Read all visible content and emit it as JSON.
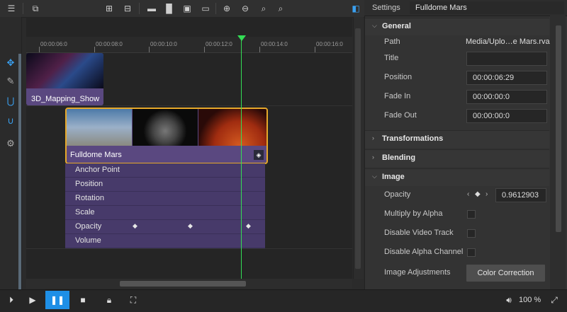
{
  "timeline": {
    "ruler_ticks": [
      "00:00:06:0",
      "00:00:08:0",
      "00:00:10:0",
      "00:00:12:0",
      "00:00:14:0",
      "00:00:16:0"
    ]
  },
  "clips": {
    "clip1": {
      "label": "3D_Mapping_Show"
    },
    "clip2": {
      "label": "Fulldome Mars"
    }
  },
  "properties": [
    "Anchor Point",
    "Position",
    "Rotation",
    "Scale",
    "Opacity",
    "Volume"
  ],
  "settings": {
    "title": "Settings",
    "clip_name": "Fulldome Mars",
    "sections": {
      "general": "General",
      "transformations": "Transformations",
      "blending": "Blending",
      "image": "Image"
    },
    "general": {
      "path_label": "Path",
      "path_value": "Media/Uplo…e Mars.rva",
      "title_label": "Title",
      "title_value": "",
      "position_label": "Position",
      "position_value": "00:00:06:29",
      "fade_in_label": "Fade In",
      "fade_in_value": "00:00:00:0",
      "fade_out_label": "Fade Out",
      "fade_out_value": "00:00:00:0"
    },
    "image": {
      "opacity_label": "Opacity",
      "opacity_value": "0.9612903",
      "multiply_label": "Multiply by Alpha",
      "disable_video_label": "Disable Video Track",
      "disable_alpha_label": "Disable Alpha Channel",
      "adjustments_label": "Image Adjustments",
      "color_correction_label": "Color Correction"
    }
  },
  "bottombar": {
    "zoom": "100 %"
  },
  "colors": {
    "playhead": "#33dd55",
    "clip_purple": "#5a4880",
    "selection": "#e6a82a",
    "accent_blue": "#3aa0f0"
  },
  "icons": [
    "play-from-start-icon",
    "play-icon",
    "pause-icon",
    "stop-icon",
    "lock-icon",
    "fit-icon",
    "volume-icon",
    "fullscreen-icon",
    "zoom-in-icon",
    "zoom-out-icon",
    "marker-icon",
    "move-icon",
    "pen-icon",
    "magnet-icon",
    "gear-icon"
  ]
}
